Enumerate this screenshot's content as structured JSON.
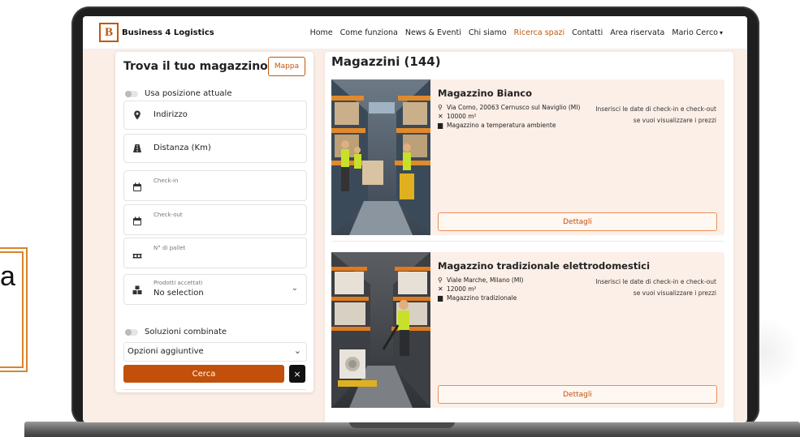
{
  "background": {
    "box_text": "a"
  },
  "nav": {
    "logo_letter": "B",
    "brand": "Business 4 Logistics",
    "links": [
      "Home",
      "Come funziona",
      "News & Eventi",
      "Chi siamo",
      "Ricerca spazi",
      "Contatti",
      "Area riservata",
      "Mario Cerco"
    ],
    "active_link": "Ricerca spazi",
    "accent_color": "#c2570c"
  },
  "filters": {
    "title": "Trova il tuo magazzino",
    "map_button": "Mappa",
    "use_position": "Usa posizione attuale",
    "address": "Indirizzo",
    "distance": "Distanza (Km)",
    "checkin": "Check-in",
    "checkout": "Check-out",
    "pallets": "N° di pallet",
    "products_label": "Prodotti accettati",
    "products_value": "No selection",
    "combined": "Soluzioni combinate",
    "options": "Opzioni aggiuntive",
    "search_button": "Cerca",
    "clear_button": "×"
  },
  "results": {
    "title": "Magazzini (144)",
    "details_label": "Dettagli",
    "price_note_line1": "Inserisci le date di check-in e check-out",
    "price_note_line2": "se vuoi visualizzare i prezzi",
    "items": [
      {
        "name": "Magazzino Bianco",
        "address": "Via Como, 20063 Cernusco sul Naviglio (MI)",
        "area": "10000 m²",
        "type": "Magazzino a temperatura ambiente"
      },
      {
        "name": "Magazzino tradizionale elettrodomestici",
        "address": "Viale Marche, Milano (MI)",
        "area": "12000 m²",
        "type": "Magazzino tradizionale"
      }
    ]
  }
}
